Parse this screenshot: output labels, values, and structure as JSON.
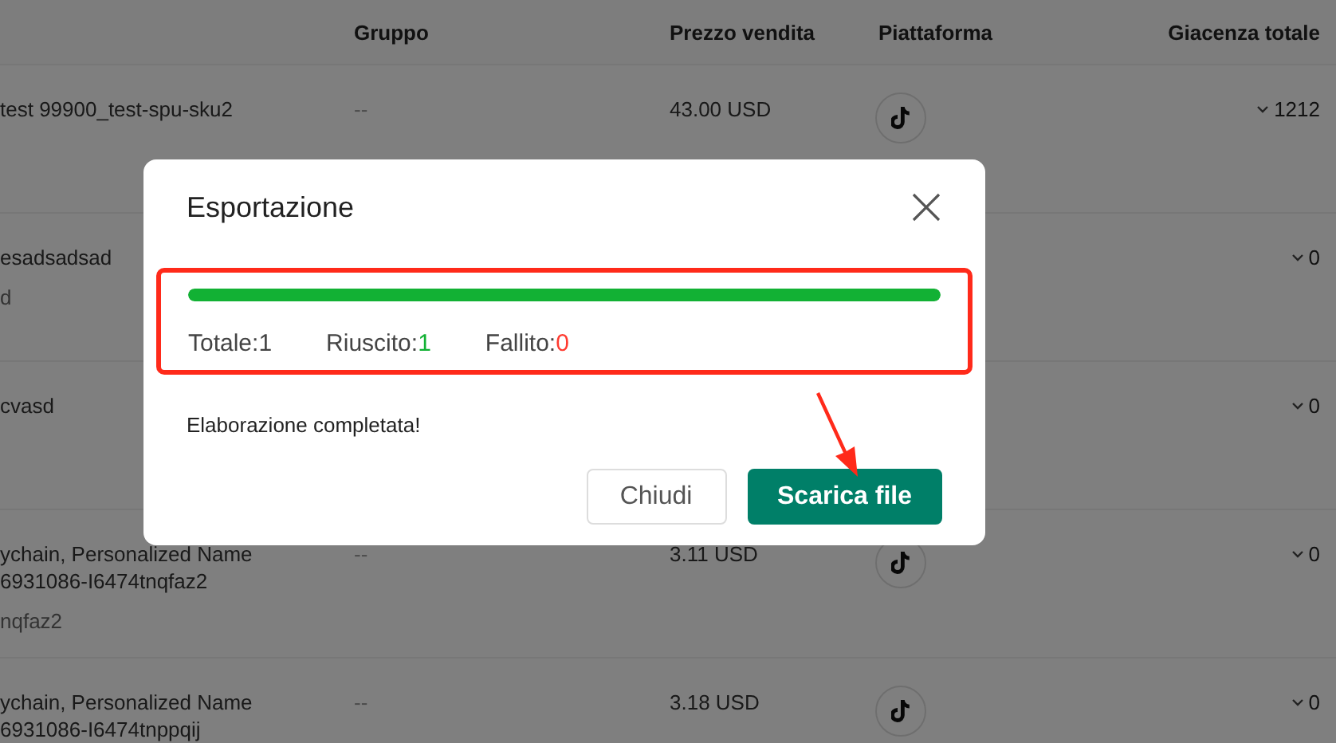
{
  "table": {
    "columns": [
      "Gruppo",
      "Prezzo vendita",
      "Piattaforma",
      "Giacenza totale"
    ],
    "rows": [
      {
        "name_lines": [
          "test 99900_test-spu-sku2"
        ],
        "group": "--",
        "price": "43.00 USD",
        "platform_icon": true,
        "stock": "1212"
      },
      {
        "name_lines": [
          "esadsadsad"
        ],
        "sub": "d",
        "stock": "0"
      },
      {
        "name_lines": [
          "cvasd"
        ],
        "stock": "0"
      },
      {
        "name_lines": [
          "ychain, Personalized Name",
          "6931086-I6474tnqfaz2"
        ],
        "sub": "nqfaz2",
        "group": "--",
        "price": "3.11 USD",
        "platform_icon": true,
        "stock": "0"
      },
      {
        "name_lines": [
          "ychain, Personalized Name",
          "6931086-I6474tnppqij"
        ],
        "group": "--",
        "price": "3.18 USD",
        "platform_icon": true,
        "stock": "0"
      }
    ]
  },
  "dialog": {
    "title": "Esportazione",
    "progress": {
      "level": 1
    },
    "stats": [
      {
        "kind": "total",
        "label": "Totale:",
        "value": "1"
      },
      {
        "kind": "success",
        "label": "Riuscito:",
        "value": "1"
      },
      {
        "kind": "failed",
        "label": "Fallito:",
        "value": "0"
      }
    ],
    "message": "Elaborazione completata!",
    "buttons": [
      {
        "kind": "secondary",
        "label": "Chiudi"
      },
      {
        "kind": "primary",
        "label": "Scarica file"
      }
    ]
  }
}
